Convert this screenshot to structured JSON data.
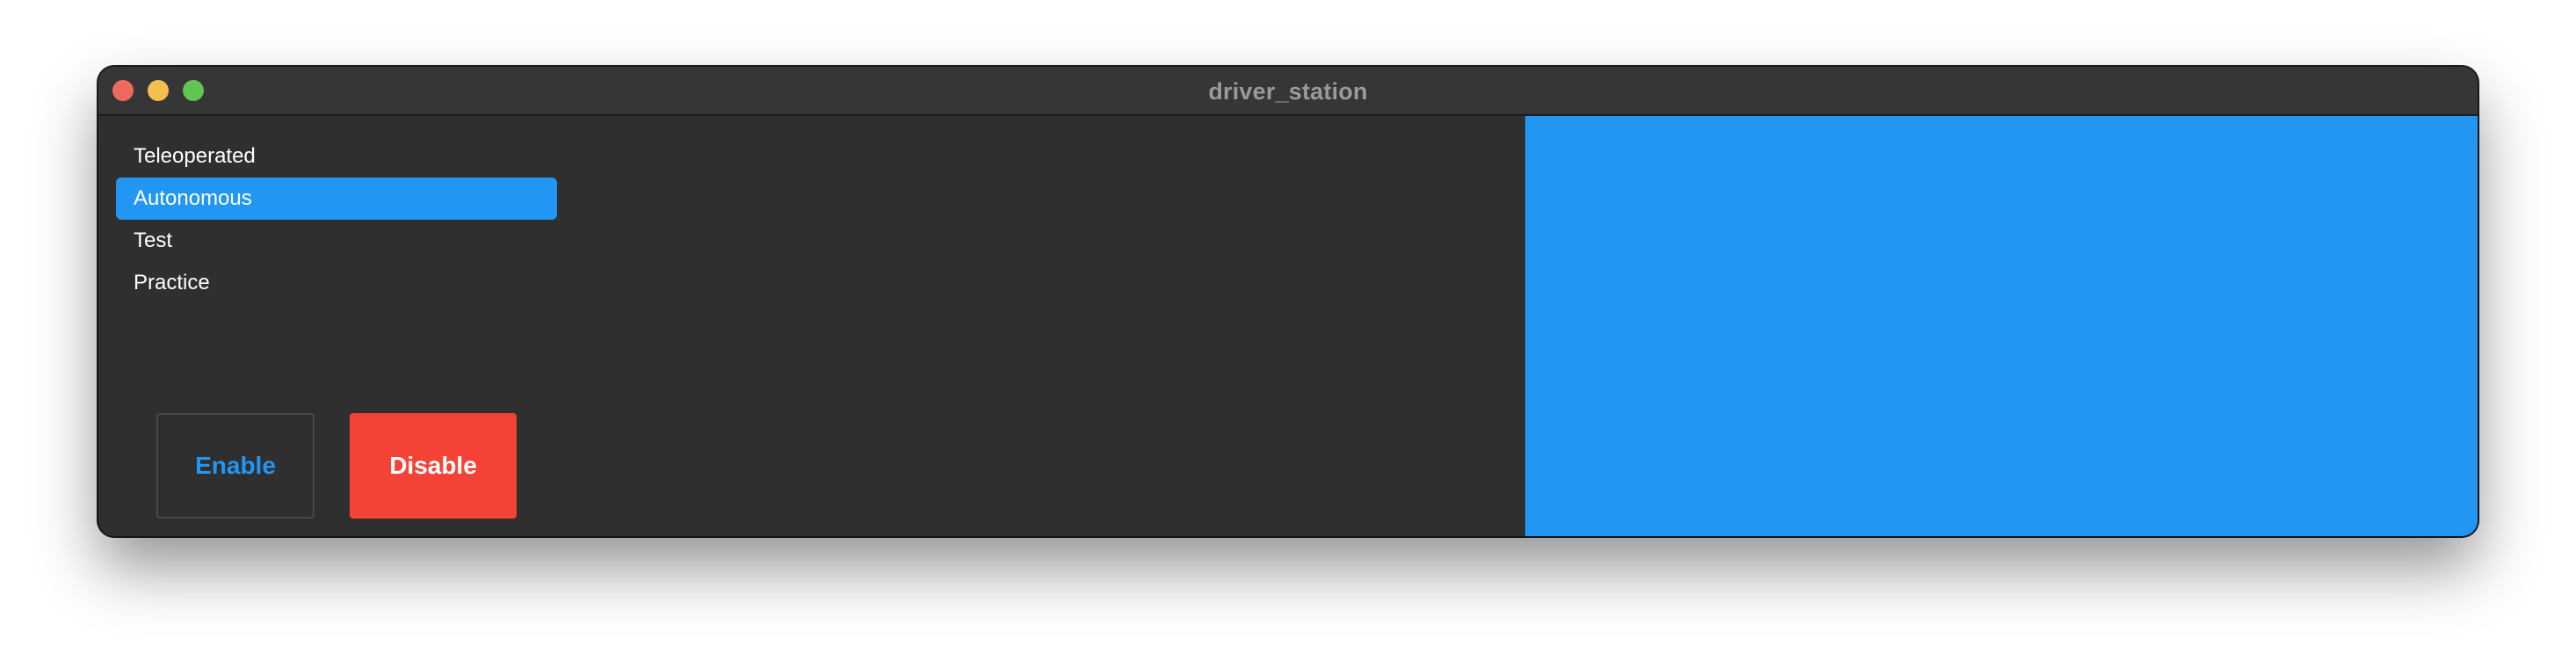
{
  "window": {
    "title": "driver_station"
  },
  "modes": {
    "items": [
      {
        "label": "Teleoperated",
        "selected": false
      },
      {
        "label": "Autonomous",
        "selected": true
      },
      {
        "label": "Test",
        "selected": false
      },
      {
        "label": "Practice",
        "selected": false
      }
    ]
  },
  "controls": {
    "enable_label": "Enable",
    "disable_label": "Disable"
  },
  "colors": {
    "accent": "#2196f3",
    "danger": "#f44336",
    "background": "#2f2f2f"
  }
}
